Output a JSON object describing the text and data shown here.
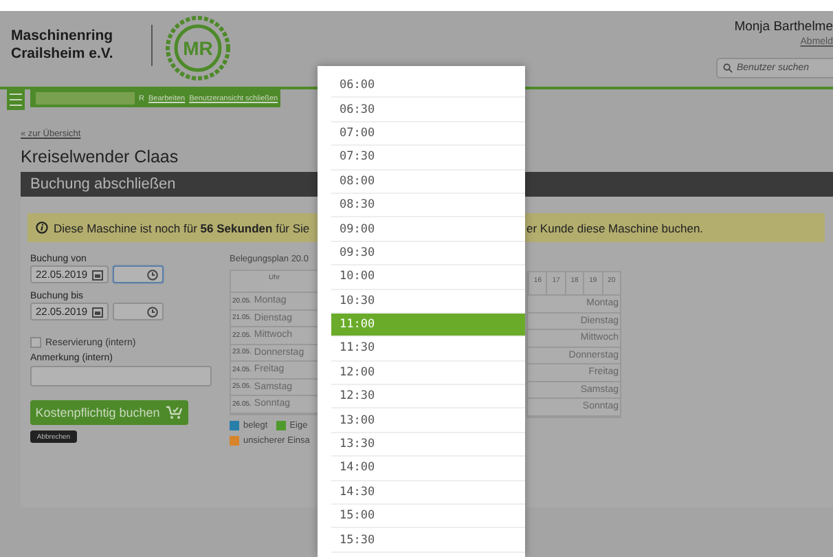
{
  "header": {
    "org_name": [
      "Maschinenring",
      "Crailsheim e.V."
    ],
    "logo_text": "MR",
    "user": "Monja Barthelme",
    "logout": "Abmeld",
    "search": {
      "placeholder": "Benutzer suchen"
    }
  },
  "user_bar": {
    "visible_suffix": "R",
    "links": [
      "Bearbeiten",
      "Benutzeransicht schließen"
    ]
  },
  "back_link": "« zur Übersicht",
  "title": "Kreiselwender Claas",
  "section_title": "Buchung abschließen",
  "notice": {
    "text_left": "Diese Maschine ist noch für **56 Sekunden** für Sie",
    "text_right": "er Kunde diese Maschine buchen."
  },
  "form": {
    "from": {
      "label": "Buchung von",
      "date": "22.05.2019",
      "focused": true
    },
    "to": {
      "label": "Buchung bis",
      "date": "22.05.2019",
      "focused": false
    },
    "reservation": {
      "label": "Reservierung (intern)",
      "checked": false
    },
    "note": {
      "label": "Anmerkung (intern)"
    },
    "submit": "Kostenpflichtig buchen",
    "cancel": "Abbrechen"
  },
  "plan": {
    "title": "Belegungsplan 20.0",
    "header_left": "Uhr",
    "hours": [
      "16",
      "17",
      "18",
      "19",
      "20"
    ],
    "rows": [
      {
        "date": "20.05.",
        "day": "Montag",
        "day_right": "Montag"
      },
      {
        "date": "21.05.",
        "day": "Dienstag",
        "day_right": "Dienstag"
      },
      {
        "date": "22.05.",
        "day": "Mittwoch",
        "day_right": "Mittwoch"
      },
      {
        "date": "23.05.",
        "day": "Donnerstag",
        "day_right": "Donnerstag"
      },
      {
        "date": "24.05.",
        "day": "Freitag",
        "day_right": "Freitag"
      },
      {
        "date": "25.05.",
        "day": "Samstag",
        "day_right": "Samstag"
      },
      {
        "date": "26.05.",
        "day": "Sonntag",
        "day_right": "Sonntag"
      }
    ],
    "legend": [
      {
        "label": "belegt",
        "color": "#2a7fa8"
      },
      {
        "label": "Eige",
        "color": "#4f9a2e"
      },
      {
        "label": "unsicherer Einsa",
        "color": "#d7842a"
      }
    ]
  },
  "time_dropdown": [
    {
      "label": "06:00",
      "selected": false
    },
    {
      "label": "06:30",
      "selected": false
    },
    {
      "label": "07:00",
      "selected": false
    },
    {
      "label": "07:30",
      "selected": false
    },
    {
      "label": "08:00",
      "selected": false
    },
    {
      "label": "08:30",
      "selected": false
    },
    {
      "label": "09:00",
      "selected": false
    },
    {
      "label": "09:30",
      "selected": false
    },
    {
      "label": "10:00",
      "selected": false
    },
    {
      "label": "10:30",
      "selected": false
    },
    {
      "label": "11:00",
      "selected": true
    },
    {
      "label": "11:30",
      "selected": false
    },
    {
      "label": "12:00",
      "selected": false
    },
    {
      "label": "12:30",
      "selected": false
    },
    {
      "label": "13:00",
      "selected": false
    },
    {
      "label": "13:30",
      "selected": false
    },
    {
      "label": "14:00",
      "selected": false
    },
    {
      "label": "14:30",
      "selected": false
    },
    {
      "label": "15:00",
      "selected": false
    },
    {
      "label": "15:30",
      "selected": false
    }
  ]
}
